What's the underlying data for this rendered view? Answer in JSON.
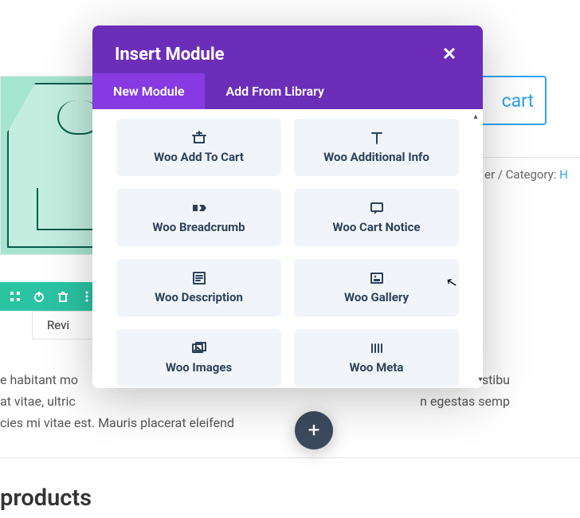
{
  "bg": {
    "cart_label": "cart",
    "category_prefix": "er / Category: ",
    "category_link": "H",
    "tab_label": "Revi",
    "paragraph_line1": "e habitant mo",
    "paragraph_line1b": "egestas. Vestibu",
    "paragraph_line2": "at vitae, ultric",
    "paragraph_line2b": "n egestas semp",
    "paragraph_line3": "cies mi vitae est. Mauris placerat eleifend",
    "heading": "products",
    "add_label": "+"
  },
  "modal": {
    "title": "Insert Module",
    "tabs": {
      "new": "New Module",
      "library": "Add From Library"
    },
    "items": [
      {
        "name": "woo-add-to-cart",
        "label": "Woo Add To Cart",
        "icon": "cart"
      },
      {
        "name": "woo-additional-info",
        "label": "Woo Additional Info",
        "icon": "text"
      },
      {
        "name": "woo-breadcrumb",
        "label": "Woo Breadcrumb",
        "icon": "breadcrumb"
      },
      {
        "name": "woo-cart-notice",
        "label": "Woo Cart Notice",
        "icon": "notice"
      },
      {
        "name": "woo-description",
        "label": "Woo Description",
        "icon": "description"
      },
      {
        "name": "woo-gallery",
        "label": "Woo Gallery",
        "icon": "gallery"
      },
      {
        "name": "woo-images",
        "label": "Woo Images",
        "icon": "images"
      },
      {
        "name": "woo-meta",
        "label": "Woo Meta",
        "icon": "meta"
      }
    ]
  },
  "colors": {
    "modal_purple": "#6c2eb9",
    "modal_purple_active": "#873ae1",
    "toolbar_teal": "#2bc4a3",
    "card_bg": "#f1f5f9",
    "link_blue": "#2ea3f2"
  }
}
